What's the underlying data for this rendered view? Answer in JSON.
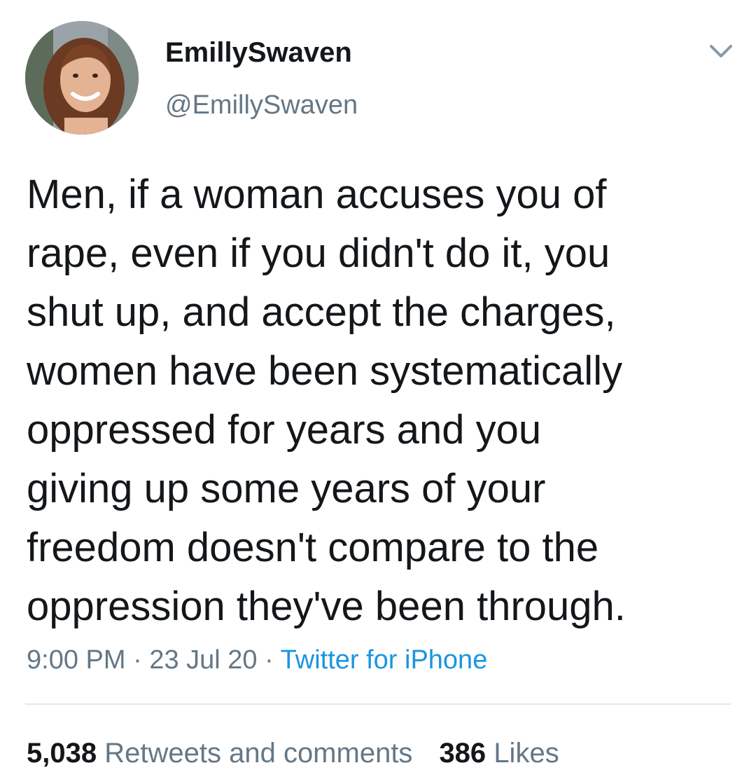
{
  "user": {
    "display_name": "EmillySwaven",
    "handle": "@EmillySwaven",
    "avatar_icon": "profile-photo"
  },
  "tweet": {
    "lines": [
      "Men, if a woman accuses you of",
      "rape, even if you didn't do it, you",
      "shut up, and accept the charges,",
      "women have been systematically",
      "oppressed for years and you",
      "giving up some years of your",
      "freedom doesn't compare to the",
      "oppression they've been through."
    ],
    "time": "9:00 PM",
    "date": "23 Jul 20",
    "separator": "·",
    "source": "Twitter for iPhone"
  },
  "stats": {
    "retweets_count": "5,038",
    "retweets_label": "Retweets and comments",
    "likes_count": "386",
    "likes_label": "Likes"
  },
  "colors": {
    "text": "#14171a",
    "secondary": "#657786",
    "link": "#1b95e0",
    "divider": "#e1e8ed"
  }
}
